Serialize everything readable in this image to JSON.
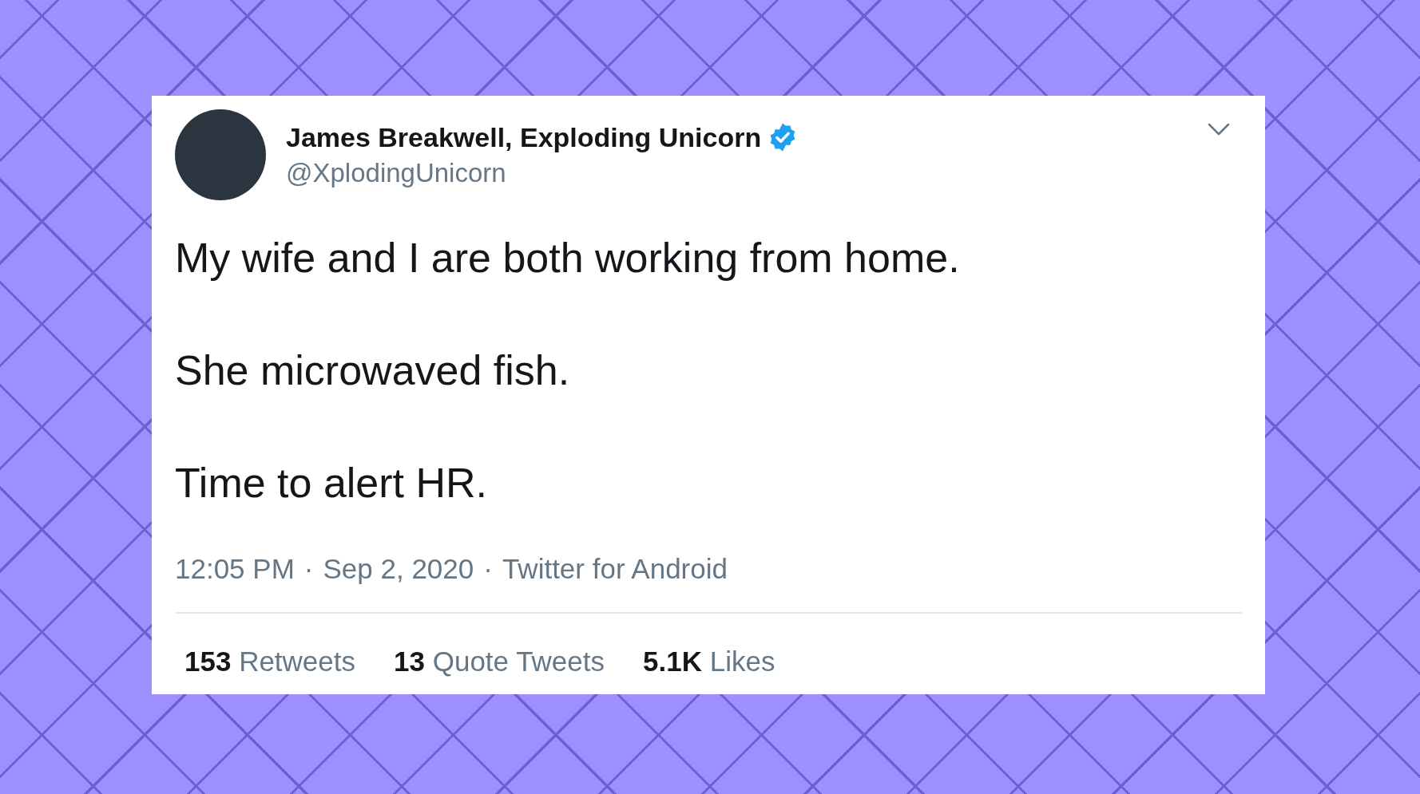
{
  "tweet": {
    "author": {
      "name": "James Breakwell, Exploding Unicorn",
      "handle": "@XplodingUnicorn"
    },
    "paragraphs": [
      "My wife and I are both working from home.",
      "She microwaved fish.",
      "Time to alert HR."
    ],
    "meta": [
      "12:05 PM",
      "Sep 2, 2020",
      "Twitter for Android"
    ],
    "meta_separator": "·",
    "stats": [
      {
        "count": "153",
        "label": "Retweets"
      },
      {
        "count": "13",
        "label": "Quote Tweets"
      },
      {
        "count": "5.1K",
        "label": "Likes"
      }
    ]
  }
}
